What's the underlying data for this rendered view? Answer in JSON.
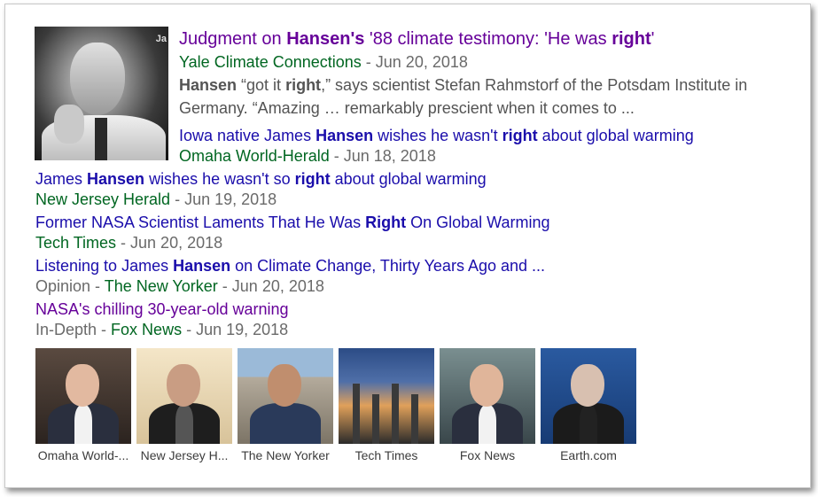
{
  "top_story": {
    "title_parts": [
      {
        "t": "Judgment on ",
        "b": false
      },
      {
        "t": "Hansen's",
        "b": true
      },
      {
        "t": " '88 climate testimony: 'He was ",
        "b": false
      },
      {
        "t": "right",
        "b": true
      },
      {
        "t": "'",
        "b": false
      }
    ],
    "source": "Yale Climate Connections",
    "date": "Jun 20, 2018",
    "snippet_parts": [
      {
        "t": "Hansen",
        "b": true
      },
      {
        "t": " “got it ",
        "b": false
      },
      {
        "t": "right",
        "b": true
      },
      {
        "t": ",” says scientist Stefan Rahmstorf of the Potsdam Institute in Germany. “Amazing … remarkably prescient when it comes to ...",
        "b": false
      }
    ]
  },
  "stories": [
    {
      "title_parts": [
        {
          "t": "Iowa native James ",
          "b": false
        },
        {
          "t": "Hansen",
          "b": true
        },
        {
          "t": " wishes he wasn't ",
          "b": false
        },
        {
          "t": "right",
          "b": true
        },
        {
          "t": " about global warming",
          "b": false
        }
      ],
      "label": "",
      "source": "Omaha World-Herald",
      "date": "Jun 18, 2018",
      "visited": false
    },
    {
      "title_parts": [
        {
          "t": "James ",
          "b": false
        },
        {
          "t": "Hansen",
          "b": true
        },
        {
          "t": " wishes he wasn't so ",
          "b": false
        },
        {
          "t": "right",
          "b": true
        },
        {
          "t": " about global warming",
          "b": false
        }
      ],
      "label": "",
      "source": "New Jersey Herald",
      "date": "Jun 19, 2018",
      "visited": false
    },
    {
      "title_parts": [
        {
          "t": "Former NASA Scientist Laments That He Was ",
          "b": false
        },
        {
          "t": "Right",
          "b": true
        },
        {
          "t": " On Global Warming",
          "b": false
        }
      ],
      "label": "",
      "source": "Tech Times",
      "date": "Jun 20, 2018",
      "visited": false
    },
    {
      "title_parts": [
        {
          "t": "Listening to James ",
          "b": false
        },
        {
          "t": "Hansen",
          "b": true
        },
        {
          "t": " on Climate Change, Thirty Years Ago and ...",
          "b": false
        }
      ],
      "label": "Opinion",
      "source": "The New Yorker",
      "date": "Jun 20, 2018",
      "visited": false
    },
    {
      "title_parts": [
        {
          "t": "NASA's chilling 30-year-old warning",
          "b": false
        }
      ],
      "label": "In-Depth",
      "source": "Fox News",
      "date": "Jun 19, 2018",
      "visited": true
    }
  ],
  "separator": " - ",
  "gallery": [
    {
      "caption": "Omaha World-...",
      "icon": "portrait-photo-icon"
    },
    {
      "caption": "New Jersey H...",
      "icon": "portrait-photo-icon"
    },
    {
      "caption": "The New Yorker",
      "icon": "landscape-photo-icon"
    },
    {
      "caption": "Tech Times",
      "icon": "smokestack-photo-icon"
    },
    {
      "caption": "Fox News",
      "icon": "portrait-photo-icon"
    },
    {
      "caption": "Earth.com",
      "icon": "portrait-photo-icon"
    }
  ],
  "thumb_mark": "Ja",
  "colors": {
    "link": "#1a0dab",
    "visited": "#660099",
    "source_green": "#006621",
    "meta_gray": "#6a6a6a",
    "snippet": "#545454"
  }
}
